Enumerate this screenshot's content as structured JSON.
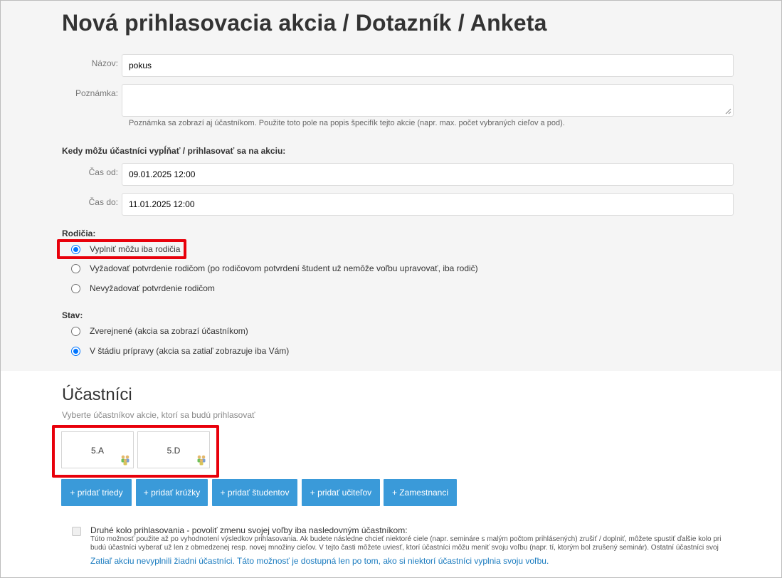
{
  "page": {
    "title": "Nová prihlasovacia akcia / Dotazník / Anketa"
  },
  "form": {
    "name_label": "Názov:",
    "name_value": "pokus",
    "note_label": "Poznámka:",
    "note_value": "",
    "note_help": "Poznámka sa zobrazí aj účastníkom. Použite toto pole na popis špecifík tejto akcie (napr. max. počet vybraných cieľov a pod).",
    "when_heading": "Kedy môžu účastníci vypĺňať / prihlasovať sa na akciu:",
    "from_label": "Čas od:",
    "from_value": "09.01.2025 12:00",
    "to_label": "Čas do:",
    "to_value": "11.01.2025 12:00"
  },
  "parents": {
    "heading": "Rodičia:",
    "options": [
      {
        "label": "Vyplniť môžu iba rodičia",
        "checked": true
      },
      {
        "label": "Vyžadovať potvrdenie rodičom (po rodičovom potvrdení študent už nemôže voľbu upravovať, iba rodič)",
        "checked": false
      },
      {
        "label": "Nevyžadovať potvrdenie rodičom",
        "checked": false
      }
    ]
  },
  "status": {
    "heading": "Stav:",
    "options": [
      {
        "label": "Zverejnené (akcia sa zobrazí účastníkom)",
        "checked": false
      },
      {
        "label": "V štádiu prípravy (akcia sa zatiaľ zobrazuje iba Vám)",
        "checked": true
      }
    ]
  },
  "participants": {
    "title": "Účastníci",
    "subtitle": "Vyberte účastníkov akcie, ktorí sa budú prihlasovať",
    "classes": [
      {
        "name": "5.A",
        "icon": "group-icon"
      },
      {
        "name": "5.D",
        "icon": "group-icon"
      }
    ],
    "buttons": [
      "+ pridať triedy",
      "+ pridať krúžky",
      "+ pridať študentov",
      "+ pridať učiteľov",
      "+ Zamestnanci"
    ]
  },
  "round2": {
    "checked": false,
    "title": "Druhé kolo prihlasovania - povoliť zmenu svojej voľby iba nasledovným účastníkom:",
    "desc_line1": "Túto možnosť použite až po vyhodnotení výsledkov prihlasovania. Ak budete následne chcieť niektoré ciele (napr. semináre s malým počtom prihlásených) zrušiť / doplniť, môžete spustiť ďalšie kolo pri",
    "desc_line2": "budú účastníci vyberať už len z obmedzenej resp. novej množiny cieľov. V tejto časti môžete uviesť, ktorí účastníci môžu meniť svoju voľbu (napr. tí, ktorým bol zrušený seminár). Ostatní účastníci svoj",
    "note": "Zatiaľ akciu nevyplnili žiadni účastníci. Táto možnosť je dostupná len po tom, ako si niektorí účastníci vyplnia svoju voľbu."
  },
  "colors": {
    "accent": "#3a9ad9",
    "highlight": "#e8000b",
    "radio": "#0075ff",
    "link": "#1a7bbf"
  }
}
